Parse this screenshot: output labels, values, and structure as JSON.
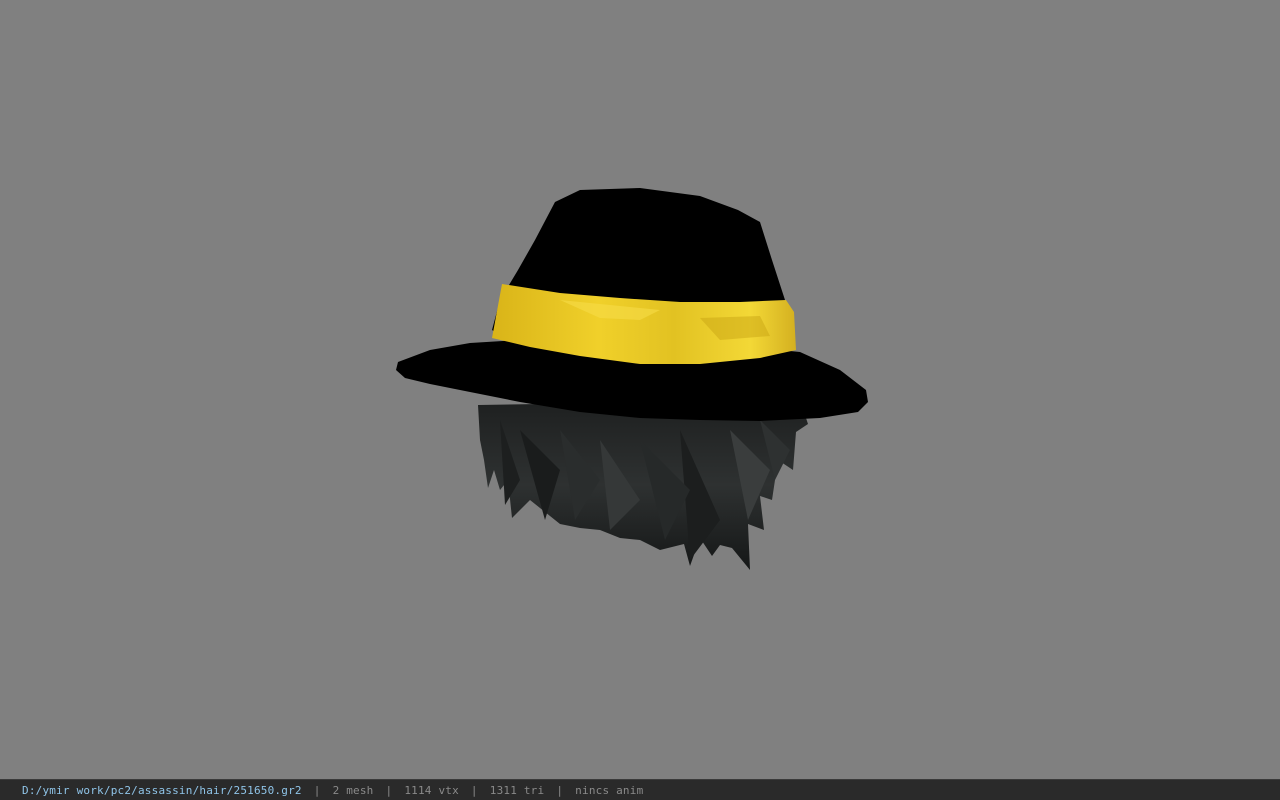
{
  "viewport": {
    "background": "#808080",
    "model": {
      "description_icon": "fedora-hat-with-hair-3d-model",
      "hat_color": "#000000",
      "band_color": "#e8c82a",
      "hair_color": "#2a2c2c"
    }
  },
  "status_bar": {
    "file_path": "D:/ymir work/pc2/assassin/hair/251650.gr2",
    "separator": "|",
    "mesh_count": "2 mesh",
    "vertex_count": "1114 vtx",
    "triangle_count": "1311 tri",
    "anim_status": "nincs anim",
    "path_color": "#8fc4e8",
    "text_color": "#8a8a8a"
  }
}
